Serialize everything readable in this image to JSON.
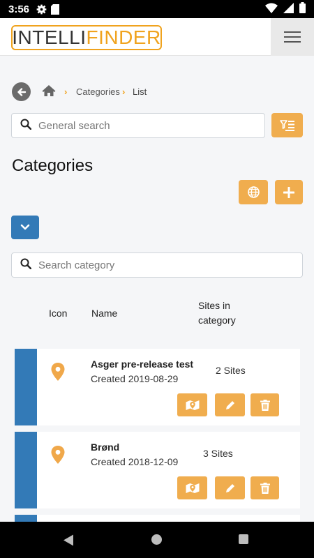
{
  "status_bar": {
    "time": "3:56"
  },
  "app": {
    "logo_part1": "INTELLI",
    "logo_part2": "FINDER"
  },
  "breadcrumb": {
    "items": [
      "Categories",
      "List"
    ]
  },
  "general_search": {
    "placeholder": "General search"
  },
  "page": {
    "title": "Categories"
  },
  "category_search": {
    "placeholder": "Search category"
  },
  "table": {
    "headers": {
      "icon": "Icon",
      "name": "Name",
      "sites": "Sites in category"
    }
  },
  "categories": [
    {
      "name": "Asger pre-release test",
      "created": "Created 2019-08-29",
      "sites": "2 Sites"
    },
    {
      "name": "Brønd",
      "created": "Created 2018-12-09",
      "sites": "3 Sites"
    }
  ],
  "colors": {
    "accent": "#f0ad4e",
    "primary": "#337ab7",
    "logo_orange": "#f0a31e"
  },
  "icons": [
    "settings-icon",
    "sd-card-icon",
    "wifi-icon",
    "signal-icon",
    "battery-icon",
    "hamburger-menu-icon",
    "back-arrow-icon",
    "home-icon",
    "chevron-right-icon",
    "search-icon",
    "filter-list-icon",
    "globe-icon",
    "plus-icon",
    "chevron-down-icon",
    "map-pin-icon",
    "map-icon",
    "pencil-icon",
    "trash-icon"
  ]
}
